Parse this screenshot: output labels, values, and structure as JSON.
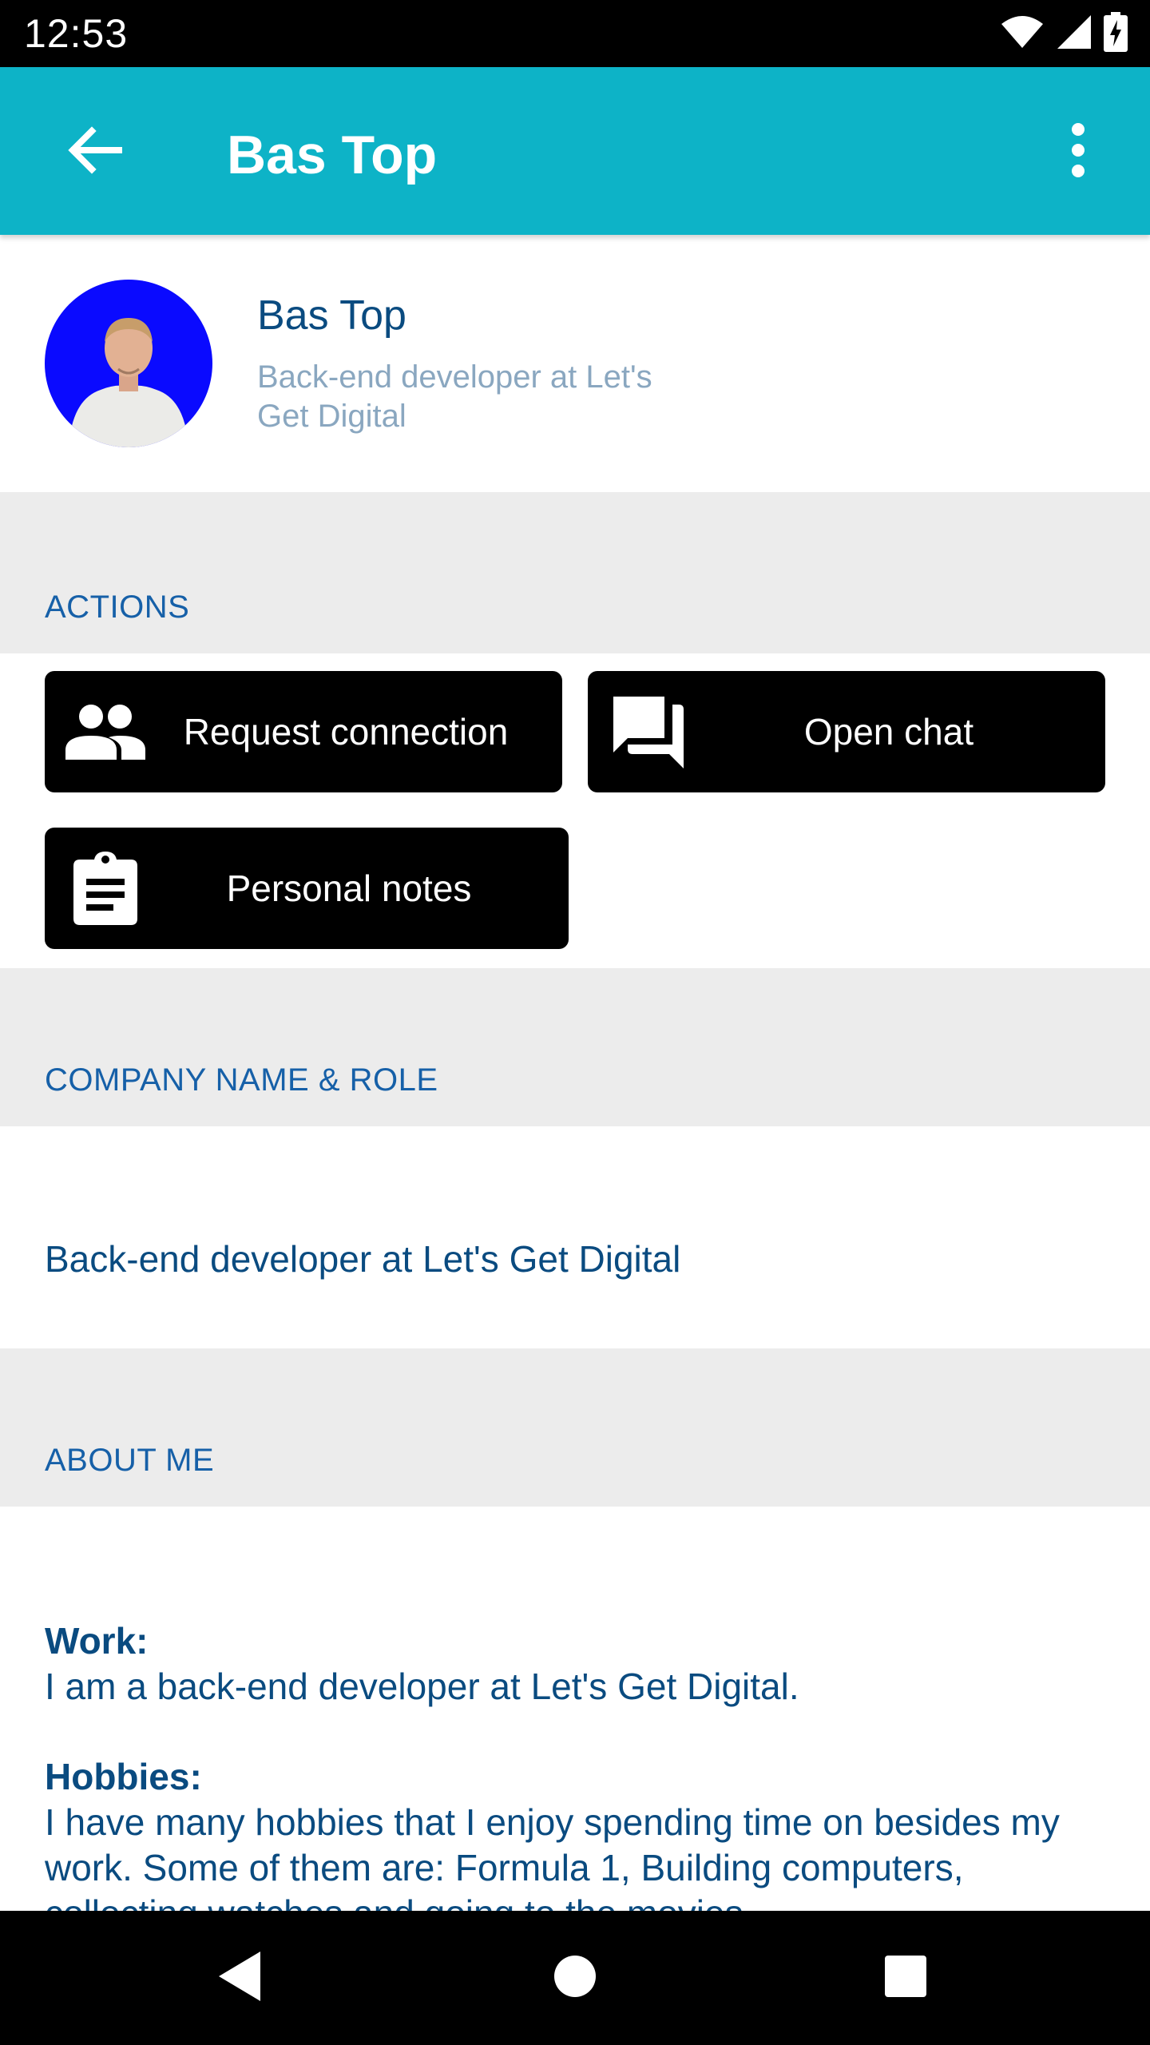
{
  "status_bar": {
    "time": "12:53",
    "icons": [
      "wifi-icon",
      "cellular-signal-icon",
      "battery-charging-icon"
    ]
  },
  "app_bar": {
    "title": "Bas Top",
    "back_icon": "arrow-left-icon",
    "menu_icon": "more-vertical-icon",
    "color": "#0db3c7"
  },
  "profile": {
    "name": "Bas Top",
    "subtitle": "Back-end developer at Let's Get Digital",
    "avatar_bg": "#0a0aff"
  },
  "sections": {
    "actions": "ACTIONS",
    "company": "COMPANY NAME & ROLE",
    "about": "ABOUT ME"
  },
  "actions": [
    {
      "label": "Request connection",
      "icon": "people-icon"
    },
    {
      "label": "Open chat",
      "icon": "chat-icon"
    },
    {
      "label": "Personal notes",
      "icon": "clipboard-icon"
    }
  ],
  "company": {
    "text": "Back-end developer at Let's Get Digital"
  },
  "about": {
    "work_label": "Work:",
    "work_text": "I am a back-end developer at Let's Get Digital.",
    "hobbies_label": "Hobbies:",
    "hobbies_text": "I have many hobbies that I enjoy spending time on besides my work. Some of them are: Formula 1, Building computers, collecting watches and going to the movies."
  },
  "nav_bar": {
    "buttons": [
      "back-triangle-icon",
      "home-circle-icon",
      "recents-square-icon"
    ]
  },
  "colors": {
    "primary_text": "#0a4b80",
    "section_title": "#1660a8",
    "section_bg": "#ececec",
    "muted_text": "#8aa7c0"
  }
}
